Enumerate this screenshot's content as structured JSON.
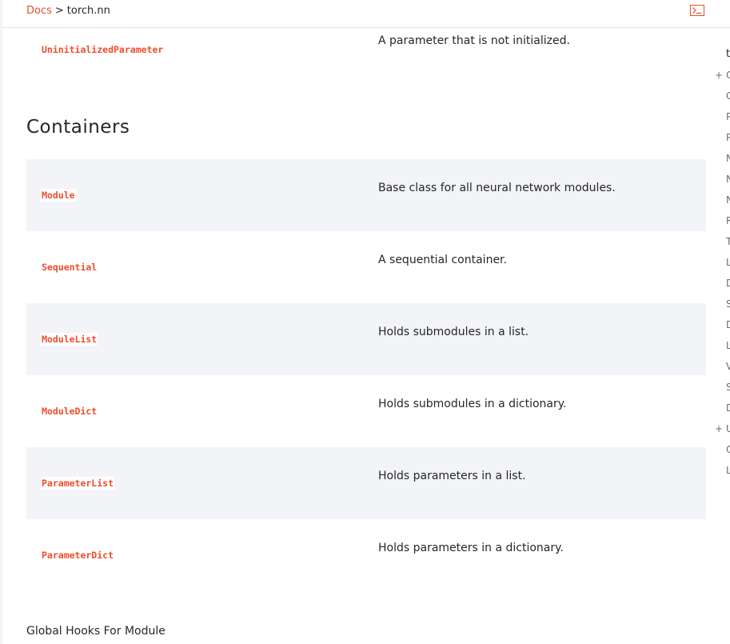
{
  "breadcrumb": {
    "root": "Docs",
    "separator": ">",
    "current": "torch.nn"
  },
  "header": {
    "terminal_icon": "terminal-icon"
  },
  "top_row": {
    "name": "UninitializedParameter",
    "description": "A parameter that is not initialized."
  },
  "section": {
    "title": "Containers",
    "rows": [
      {
        "name": "Module",
        "description": "Base class for all neural network modules."
      },
      {
        "name": "Sequential",
        "description": "A sequential container."
      },
      {
        "name": "ModuleList",
        "description": "Holds submodules in a list."
      },
      {
        "name": "ModuleDict",
        "description": "Holds submodules in a dictionary."
      },
      {
        "name": "ParameterList",
        "description": "Holds parameters in a list."
      },
      {
        "name": "ParameterDict",
        "description": "Holds parameters in a dictionary."
      }
    ]
  },
  "next_section": {
    "title": "Global Hooks For Module"
  },
  "right_nav": {
    "title": "t",
    "items": [
      {
        "plus": "+",
        "label": "C"
      },
      {
        "plus": "",
        "label": "C"
      },
      {
        "plus": "",
        "label": "P"
      },
      {
        "plus": "",
        "label": "P"
      },
      {
        "plus": "",
        "label": "N"
      },
      {
        "plus": "",
        "label": "N"
      },
      {
        "plus": "",
        "label": "N"
      },
      {
        "plus": "",
        "label": "R"
      },
      {
        "plus": "",
        "label": "T"
      },
      {
        "plus": "",
        "label": "L"
      },
      {
        "plus": "",
        "label": "D"
      },
      {
        "plus": "",
        "label": "S"
      },
      {
        "plus": "",
        "label": "D"
      },
      {
        "plus": "",
        "label": "L"
      },
      {
        "plus": "",
        "label": "V"
      },
      {
        "plus": "",
        "label": "S"
      },
      {
        "plus": "",
        "label": "D"
      },
      {
        "plus": "+",
        "label": "U"
      },
      {
        "plus": "",
        "label": "C"
      },
      {
        "plus": "",
        "label": "L"
      }
    ]
  },
  "colors": {
    "accent": "#ee4c2c",
    "row_shade": "#f3f4f7",
    "text": "#262626"
  }
}
